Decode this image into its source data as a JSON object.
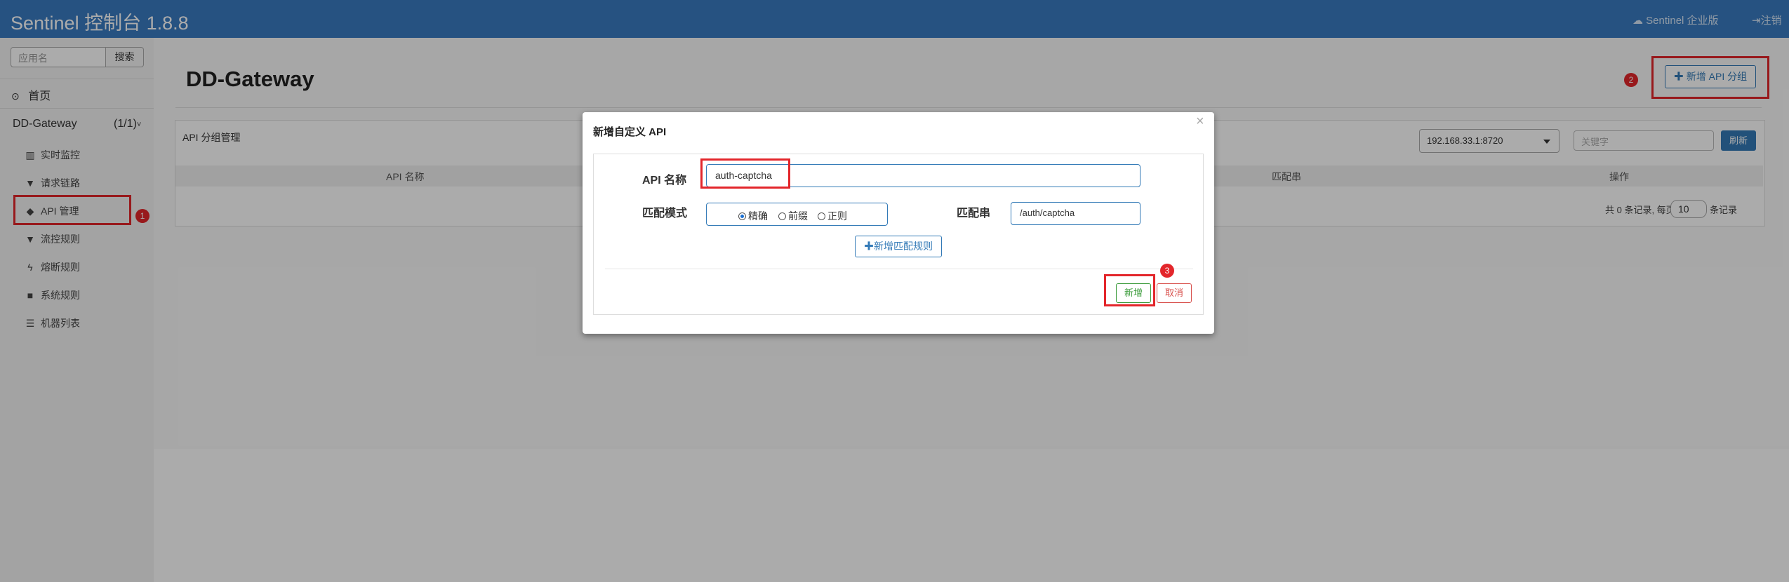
{
  "header": {
    "title": "Sentinel 控制台 1.8.8",
    "enterprise_label": "Sentinel 企业版",
    "logout_label": "注销"
  },
  "sidebar": {
    "search_placeholder": "应用名",
    "search_button": "搜索",
    "home_label": "首页",
    "app_name": "DD-Gateway",
    "app_count": "(1/1)",
    "items": [
      {
        "label": "实时监控",
        "icon": "bar-chart-icon"
      },
      {
        "label": "请求链路",
        "icon": "filter-icon"
      },
      {
        "label": "API 管理",
        "icon": "tags-icon"
      },
      {
        "label": "流控规则",
        "icon": "filter-icon"
      },
      {
        "label": "熔断规则",
        "icon": "flash-icon"
      },
      {
        "label": "系统规则",
        "icon": "lock-icon"
      },
      {
        "label": "机器列表",
        "icon": "list-icon"
      }
    ]
  },
  "main": {
    "page_title": "DD-Gateway",
    "add_group_button": "新增 API 分组",
    "panel_title": "API 分组管理",
    "machine_select": "192.168.33.1:8720",
    "keyword_placeholder": "关键字",
    "refresh_button": "刷新",
    "columns": [
      "API 名称",
      "匹配串",
      "操作"
    ],
    "pager": {
      "prefix": "共 0 条记录, 每页",
      "page_size": "10",
      "suffix": "条记录"
    }
  },
  "modal": {
    "title": "新增自定义 API",
    "close": "×",
    "api_name_label": "API 名称",
    "api_name_value": "auth-captcha",
    "match_mode_label": "匹配模式",
    "match_modes": [
      "精确",
      "前缀",
      "正则"
    ],
    "selected_mode": "精确",
    "match_string_label": "匹配串",
    "match_string_value": "/auth/captcha",
    "add_rule_button": "新增匹配规则",
    "submit_button": "新增",
    "cancel_button": "取消"
  },
  "annotations": {
    "badges": [
      "1",
      "2",
      "3"
    ],
    "color": "#e3262b"
  },
  "colors": {
    "header": "#3a7bc1",
    "primary": "#337ab7",
    "success": "#3c9c3c",
    "danger": "#d9534f"
  }
}
